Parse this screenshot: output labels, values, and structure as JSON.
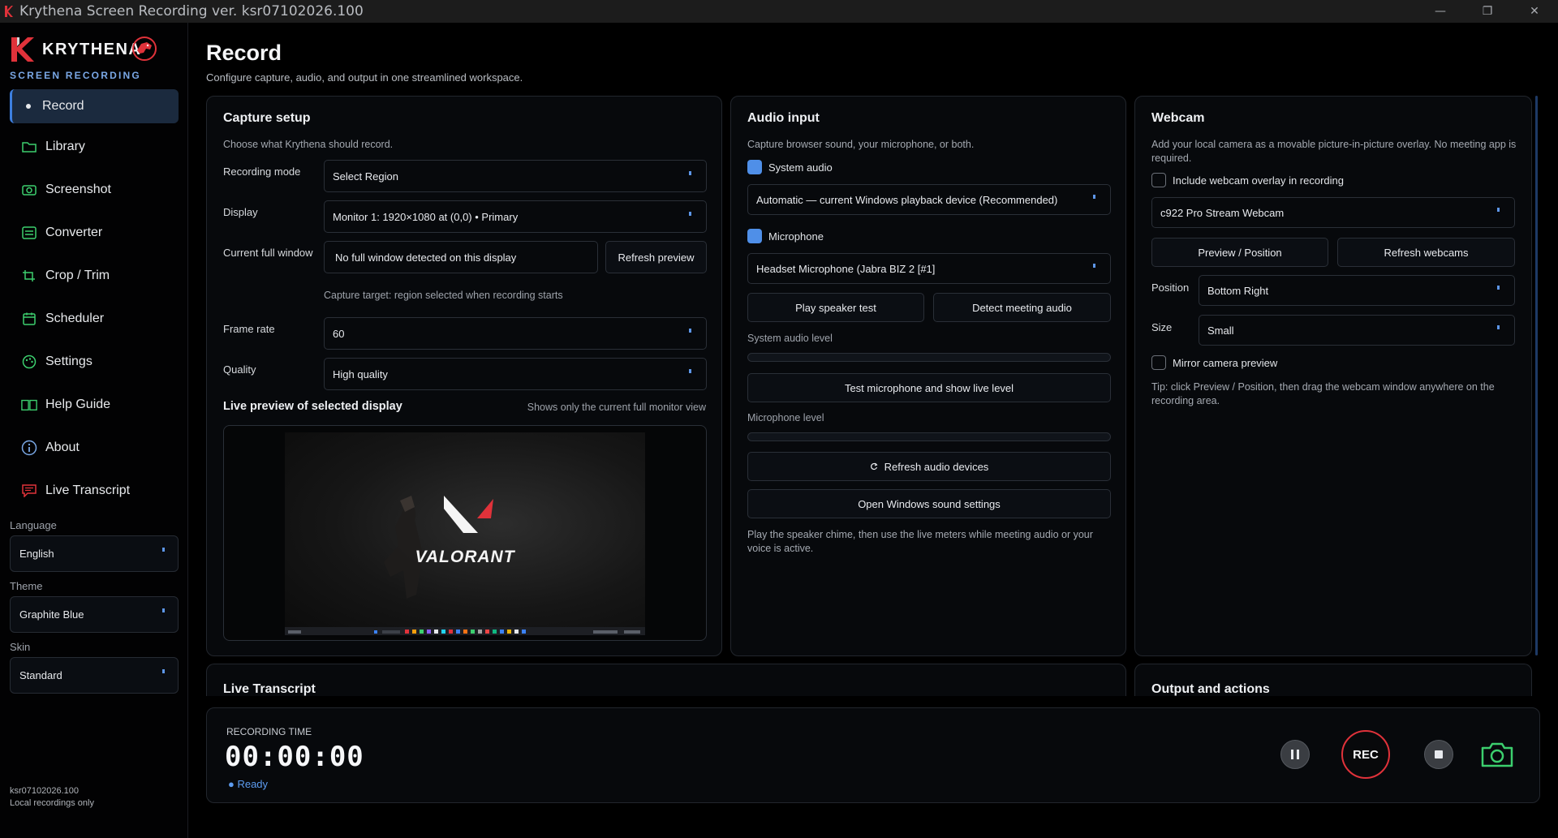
{
  "window": {
    "title": "Krythena Screen Recording ver. ksr07102026.100",
    "minimize": "—",
    "maximize": "❐",
    "close": "✕"
  },
  "brand": {
    "name": "KRYTHENA",
    "subtitle": "SCREEN RECORDING"
  },
  "sidebar": {
    "items": [
      {
        "label": "Record",
        "icon": "dot-icon",
        "active": true
      },
      {
        "label": "Library",
        "icon": "folder-icon"
      },
      {
        "label": "Screenshot",
        "icon": "camera-icon"
      },
      {
        "label": "Converter",
        "icon": "converter-icon"
      },
      {
        "label": "Crop / Trim",
        "icon": "crop-icon"
      },
      {
        "label": "Scheduler",
        "icon": "calendar-icon"
      },
      {
        "label": "Settings",
        "icon": "palette-icon"
      },
      {
        "label": "Help Guide",
        "icon": "book-icon"
      },
      {
        "label": "About",
        "icon": "info-icon"
      },
      {
        "label": "Live Transcript",
        "icon": "transcript-icon"
      }
    ],
    "language_label": "Language",
    "language_value": "English",
    "theme_label": "Theme",
    "theme_value": "Graphite Blue",
    "skin_label": "Skin",
    "skin_value": "Standard",
    "version": "ksr07102026.100",
    "storage_note": "Local recordings only"
  },
  "page": {
    "title": "Record",
    "subtitle": "Configure capture, audio, and output in one streamlined workspace."
  },
  "capture": {
    "title": "Capture setup",
    "desc": "Choose what Krythena should record.",
    "mode_label": "Recording mode",
    "mode_value": "Select Region",
    "display_label": "Display",
    "display_value": "Monitor 1: 1920×1080 at (0,0) • Primary",
    "window_label": "Current full window",
    "window_value": "No full window detected on this display",
    "refresh_preview": "Refresh preview",
    "target_hint": "Capture target: region selected when recording starts",
    "fps_label": "Frame rate",
    "fps_value": "60",
    "quality_label": "Quality",
    "quality_value": "High quality",
    "preview_title": "Live preview of selected display",
    "preview_note": "Shows only the current full monitor view",
    "preview_game_logo": "VALORANT"
  },
  "audio": {
    "title": "Audio input",
    "desc": "Capture browser sound, your microphone, or both.",
    "system_audio_label": "System audio",
    "system_audio_checked": true,
    "system_device": "Automatic — current Windows playback device (Recommended)",
    "microphone_label": "Microphone",
    "microphone_checked": true,
    "mic_device": "Headset Microphone (Jabra BIZ 2  [#1]",
    "play_speaker_test": "Play speaker test",
    "detect_meeting_audio": "Detect meeting audio",
    "system_level_label": "System audio level",
    "system_level": 0,
    "test_mic": "Test microphone and show live level",
    "mic_level_label": "Microphone level",
    "mic_level": 0,
    "refresh_devices": "Refresh audio devices",
    "open_sound_settings": "Open Windows sound settings",
    "tip": "Play the speaker chime, then use the live meters while meeting audio or your voice is active."
  },
  "webcam": {
    "title": "Webcam",
    "desc": "Add your local camera as a movable picture-in-picture overlay. No meeting app is required.",
    "include_label": "Include webcam overlay in recording",
    "include_checked": false,
    "device": "c922 Pro Stream Webcam",
    "preview_position": "Preview / Position",
    "refresh_webcams": "Refresh webcams",
    "position_label": "Position",
    "position_value": "Bottom Right",
    "size_label": "Size",
    "size_value": "Small",
    "mirror_label": "Mirror camera preview",
    "mirror_checked": false,
    "tip": "Tip: click Preview / Position, then drag the webcam window anywhere on the recording area."
  },
  "sections": {
    "live_transcript": "Live Transcript",
    "output_actions": "Output and actions"
  },
  "recorder": {
    "time_label": "RECORDING TIME",
    "time": "00:00:00",
    "status": "● Ready",
    "rec_label": "REC"
  },
  "colors": {
    "accent": "#4f8fe8",
    "rec_red": "#e0323a",
    "snapshot_green": "#3ccf6e",
    "brand_red": "#e0323a"
  }
}
